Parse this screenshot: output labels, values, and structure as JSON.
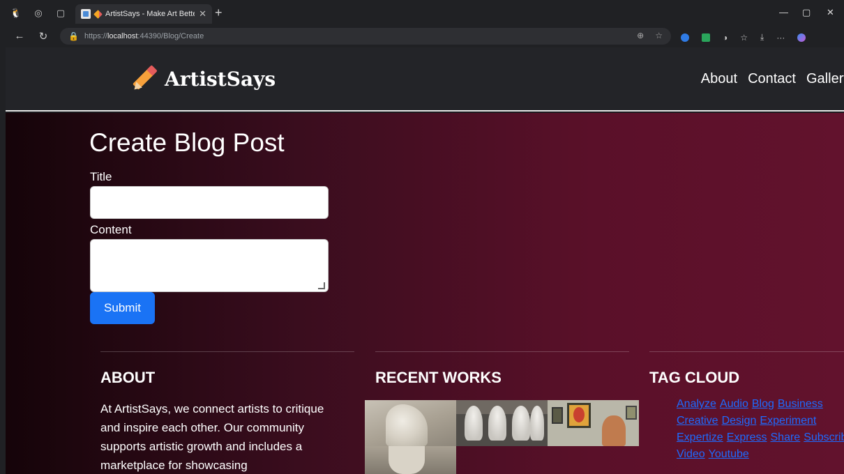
{
  "browser": {
    "tab_title": "ArtistSays - Make Art Better",
    "url_prefix": "https://",
    "url_host": "localhost",
    "url_path": ":44390/Blog/Create"
  },
  "site": {
    "brand": "ArtistSays",
    "nav": [
      "About",
      "Contact",
      "Gallery"
    ]
  },
  "form": {
    "heading": "Create Blog Post",
    "title_label": "Title",
    "title_value": "",
    "content_label": "Content",
    "content_value": "",
    "submit_label": "Submit"
  },
  "footer": {
    "about_heading": "ABOUT",
    "about_text": "At ArtistSays, we connect artists to critique and inspire each other. Our community supports artistic growth and includes a marketplace for showcasing",
    "recent_heading": "RECENT WORKS",
    "tags_heading": "TAG CLOUD",
    "tags": [
      "Analyze",
      "Audio",
      "Blog",
      "Business",
      "Creative",
      "Design",
      "Experiment",
      "Expertize",
      "Express",
      "Share",
      "Subscribe",
      "Video",
      "Youtube"
    ]
  },
  "colors": {
    "accent": "#1a73f5",
    "link": "#1e6bff",
    "header_bg": "#232428",
    "gradient_dark": "#150409",
    "gradient_light": "#62122d"
  }
}
